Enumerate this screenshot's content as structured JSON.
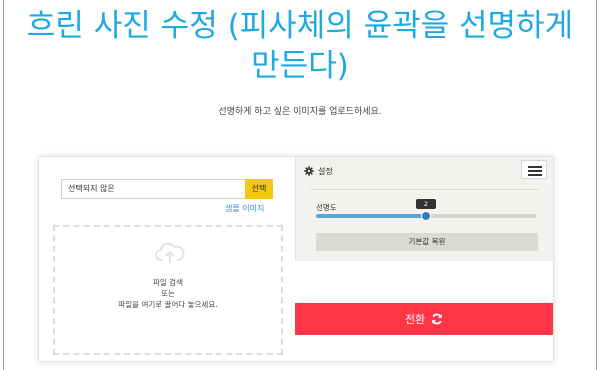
{
  "page": {
    "title": "흐린 사진 수정 (피사체의 윤곽을 선명하게 만든다)",
    "subtitle": "선명하게 하고 싶은 이미지를 업로드하세요."
  },
  "upload": {
    "file_placeholder": "선택되지 않은",
    "select_label": "선택",
    "sample_link": "샘플 이미지",
    "drop_line1": "파일 검색",
    "drop_line2": "또는",
    "drop_line3": "파일을 여기로 끌어다 놓으세요.",
    "upload_icon": "cloud-upload-icon"
  },
  "settings": {
    "header_label": "설정",
    "gear_icon": "gear-icon",
    "menu_icon": "hamburger-menu-icon",
    "sharpness": {
      "label": "선명도",
      "value": "2",
      "fraction": 0.5
    },
    "reset_label": "기본값 복원"
  },
  "convert": {
    "label": "전환",
    "icon": "refresh-icon"
  },
  "colors": {
    "title": "#1fa9e1",
    "select_button": "#f2c811",
    "convert_button": "#ff3447",
    "slider": "#5aa7d1",
    "link": "#3a8fd8"
  }
}
